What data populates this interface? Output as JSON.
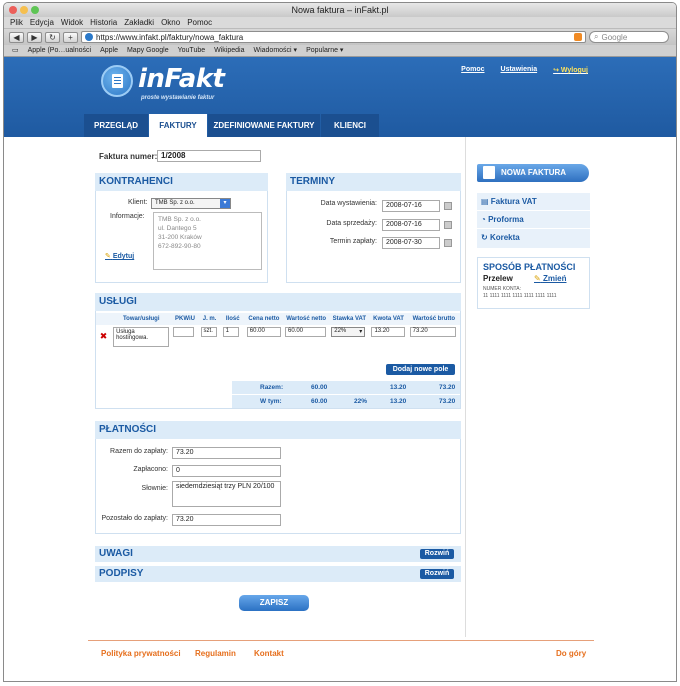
{
  "browser": {
    "title": "Nowa faktura – inFakt.pl",
    "menu": [
      "Plik",
      "Edycja",
      "Widok",
      "Historia",
      "Zakładki",
      "Okno",
      "Pomoc"
    ],
    "url": "https://www.infakt.pl/faktury/nowa_faktura",
    "search_placeholder": "Google",
    "bookmarks": [
      "Apple (Po…ualności",
      "Apple",
      "Mapy Google",
      "YouTube",
      "Wikipedia",
      "Wiadomości ▾",
      "Popularne ▾"
    ]
  },
  "site": {
    "logo": "inFakt",
    "tagline": "proste wystawianie faktur",
    "toplinks": {
      "help": "Pomoc",
      "settings": "Ustawienia",
      "logout": "Wyloguj"
    },
    "tabs": [
      "PRZEGLĄD",
      "FAKTURY",
      "ZDEFINIOWANE FAKTURY",
      "KLIENCI"
    ]
  },
  "invoice": {
    "number_label": "Faktura numer:",
    "number_value": "1/2008"
  },
  "contractors": {
    "title": "KONTRAHENCI",
    "client_label": "Klient:",
    "client_value": "TMB Sp. z o.o.",
    "info_label": "Informacje:",
    "info_lines": [
      "TMB Sp. z o.o.",
      "ul. Dantego 5",
      "31-200 Kraków",
      "672-892-90-80"
    ],
    "edit_label": "Edytuj"
  },
  "terms": {
    "title": "TERMINY",
    "issue_label": "Data wystawienia:",
    "issue_value": "2008-07-16",
    "sale_label": "Data sprzedaży:",
    "sale_value": "2008-07-16",
    "payment_label": "Termin zapłaty:",
    "payment_value": "2008-07-30"
  },
  "services": {
    "title": "USŁUGI",
    "headers": [
      "Towar/usługi",
      "PKWiU",
      "J. m.",
      "Ilość",
      "Cena netto",
      "Wartość netto",
      "Stawka VAT",
      "Kwota VAT",
      "Wartość brutto"
    ],
    "row": {
      "name": "Usługa hostingowa.",
      "pkwiu": "",
      "unit": "szt.",
      "qty": "1",
      "net_price": "60.00",
      "net_value": "60.00",
      "vat_rate": "22%",
      "vat_amount": "13.20",
      "gross": "73.20"
    },
    "add_button": "Dodaj nowe pole",
    "sum_label": "Razem:",
    "sum_net": "60.00",
    "sum_vat": "13.20",
    "sum_gross": "73.20",
    "incl_label": "W tym:",
    "incl_net": "60.00",
    "incl_rate": "22%",
    "incl_vat": "13.20",
    "incl_gross": "73.20"
  },
  "payments": {
    "title": "PŁATNOŚCI",
    "total_label": "Razem do zapłaty:",
    "total_value": "73.20",
    "paid_label": "Zapłacono:",
    "paid_value": "0",
    "words_label": "Słownie:",
    "words_value": "siedemdziesiąt trzy PLN 20/100",
    "remaining_label": "Pozostało do zapłaty:",
    "remaining_value": "73.20"
  },
  "notes": {
    "title": "UWAGI",
    "expand": "Rozwiń"
  },
  "signatures": {
    "title": "PODPISY",
    "expand": "Rozwiń"
  },
  "save_button": "ZAPISZ",
  "sidebar": {
    "new_invoice": "NOWA FAKTURA",
    "links": [
      "Faktura VAT",
      "Proforma",
      "Korekta"
    ],
    "payment_title": "SPOSÓB PŁATNOŚCI",
    "payment_method": "Przelew",
    "change": "Zmień",
    "account_label": "NUMER KONTA:",
    "account_number": "11 1111 1111 1111 1111 1111 1111"
  },
  "footer": {
    "privacy": "Polityka prywatności",
    "rules": "Regulamin",
    "contact": "Kontakt",
    "top": "Do góry"
  }
}
